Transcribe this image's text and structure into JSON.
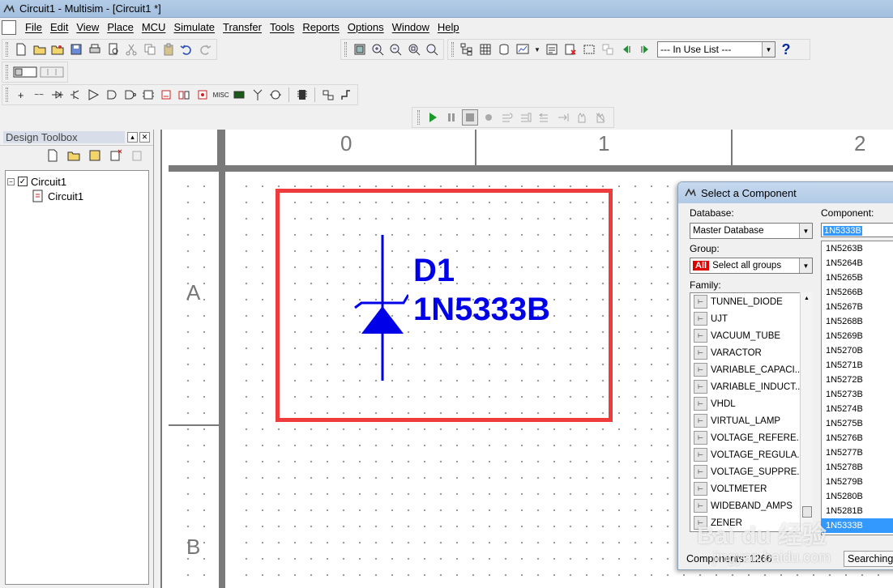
{
  "window": {
    "title": "Circuit1 - Multisim - [Circuit1 *]"
  },
  "menu": [
    "File",
    "Edit",
    "View",
    "Place",
    "MCU",
    "Simulate",
    "Transfer",
    "Tools",
    "Reports",
    "Options",
    "Window",
    "Help"
  ],
  "toolbar": {
    "in_use_list": "--- In Use List ---",
    "help_glyph": "?"
  },
  "design_toolbox": {
    "title": "Design Toolbox",
    "tree_root": "Circuit1",
    "tree_child": "Circuit1"
  },
  "workspace": {
    "ruler_cols": [
      "0",
      "1",
      "2"
    ],
    "ruler_rows": [
      "A",
      "B"
    ],
    "component_ref": "D1",
    "component_part": "1N5333B"
  },
  "dialog": {
    "title": "Select a Component",
    "database_label": "Database:",
    "database_value": "Master Database",
    "group_label": "Group:",
    "group_badge": "All",
    "group_value": "Select all groups",
    "family_label": "Family:",
    "component_label": "Component:",
    "component_value": "1N5333B",
    "families": [
      {
        "name": "TUNNEL_DIODE",
        "icon": "tunnel-diode-icon"
      },
      {
        "name": "UJT",
        "icon": "ujt-icon"
      },
      {
        "name": "VACUUM_TUBE",
        "icon": "vacuum-tube-icon"
      },
      {
        "name": "VARACTOR",
        "icon": "varactor-icon"
      },
      {
        "name": "VARIABLE_CAPACI...",
        "icon": "variable-capacitor-icon"
      },
      {
        "name": "VARIABLE_INDUCT...",
        "icon": "variable-inductor-icon"
      },
      {
        "name": "VHDL",
        "icon": "vhdl-icon"
      },
      {
        "name": "VIRTUAL_LAMP",
        "icon": "virtual-lamp-icon"
      },
      {
        "name": "VOLTAGE_REFERE...",
        "icon": "voltage-reference-icon"
      },
      {
        "name": "VOLTAGE_REGULA...",
        "icon": "voltage-regulator-icon"
      },
      {
        "name": "VOLTAGE_SUPPRE...",
        "icon": "voltage-suppressor-icon"
      },
      {
        "name": "VOLTMETER",
        "icon": "voltmeter-icon"
      },
      {
        "name": "WIDEBAND_AMPS",
        "icon": "wideband-amps-icon"
      },
      {
        "name": "ZENER",
        "icon": "zener-icon"
      }
    ],
    "components": [
      "1N5263B",
      "1N5264B",
      "1N5265B",
      "1N5266B",
      "1N5267B",
      "1N5268B",
      "1N5269B",
      "1N5270B",
      "1N5271B",
      "1N5272B",
      "1N5273B",
      "1N5274B",
      "1N5275B",
      "1N5276B",
      "1N5277B",
      "1N5278B",
      "1N5279B",
      "1N5280B",
      "1N5281B",
      "1N5333B"
    ],
    "selected_component": "1N5333B",
    "components_count": "Components: 1266",
    "searching_label": "Searching"
  },
  "watermark": {
    "main": "Bai du 经验",
    "sub": "jingyan.baidu.com"
  }
}
